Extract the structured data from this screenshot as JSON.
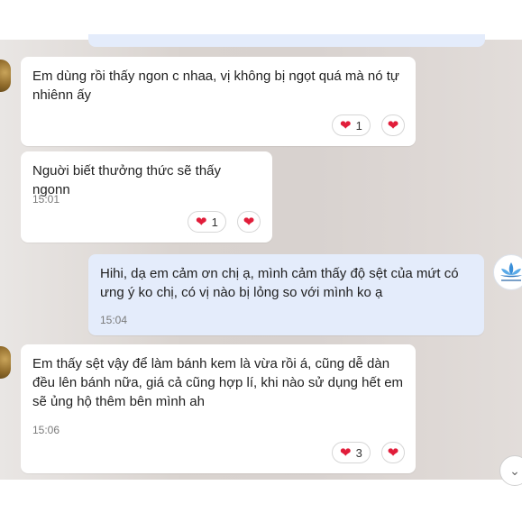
{
  "messages": [
    {
      "text": "Em dùng rồi thấy ngon c nhaa, vị không bị ngọt quá mà nó tự nhiênn ấy",
      "reaction_count": "1"
    },
    {
      "text": "Nguời biết thưởng thức sẽ thấy ngonn",
      "time": "15:01",
      "reaction_count": "1"
    },
    {
      "text": "Hihi, dạ em cảm ơn chị ạ, mình cảm thấy độ sệt của mứt có ưng ý ko chị, có vị nào bị lỏng so với mình ko ạ",
      "time": "15:04"
    },
    {
      "text": "Em thấy sệt vậy để làm bánh kem là vừa rồi á, cũng dễ dàn đều lên bánh nữa, giá cả cũng hợp lí, khi nào sử dụng hết em sẽ ủng hộ thêm bên mình ah",
      "time": "15:06",
      "reaction_count": "3"
    }
  ],
  "icons": {
    "heart": "heart-icon",
    "scroll": "chevron-down-icon",
    "avatar_right": "lotus-logo-avatar"
  },
  "colors": {
    "incoming_bubble": "#ffffff",
    "outgoing_bubble": "#e4ecfb",
    "heart": "#e11d3a"
  }
}
